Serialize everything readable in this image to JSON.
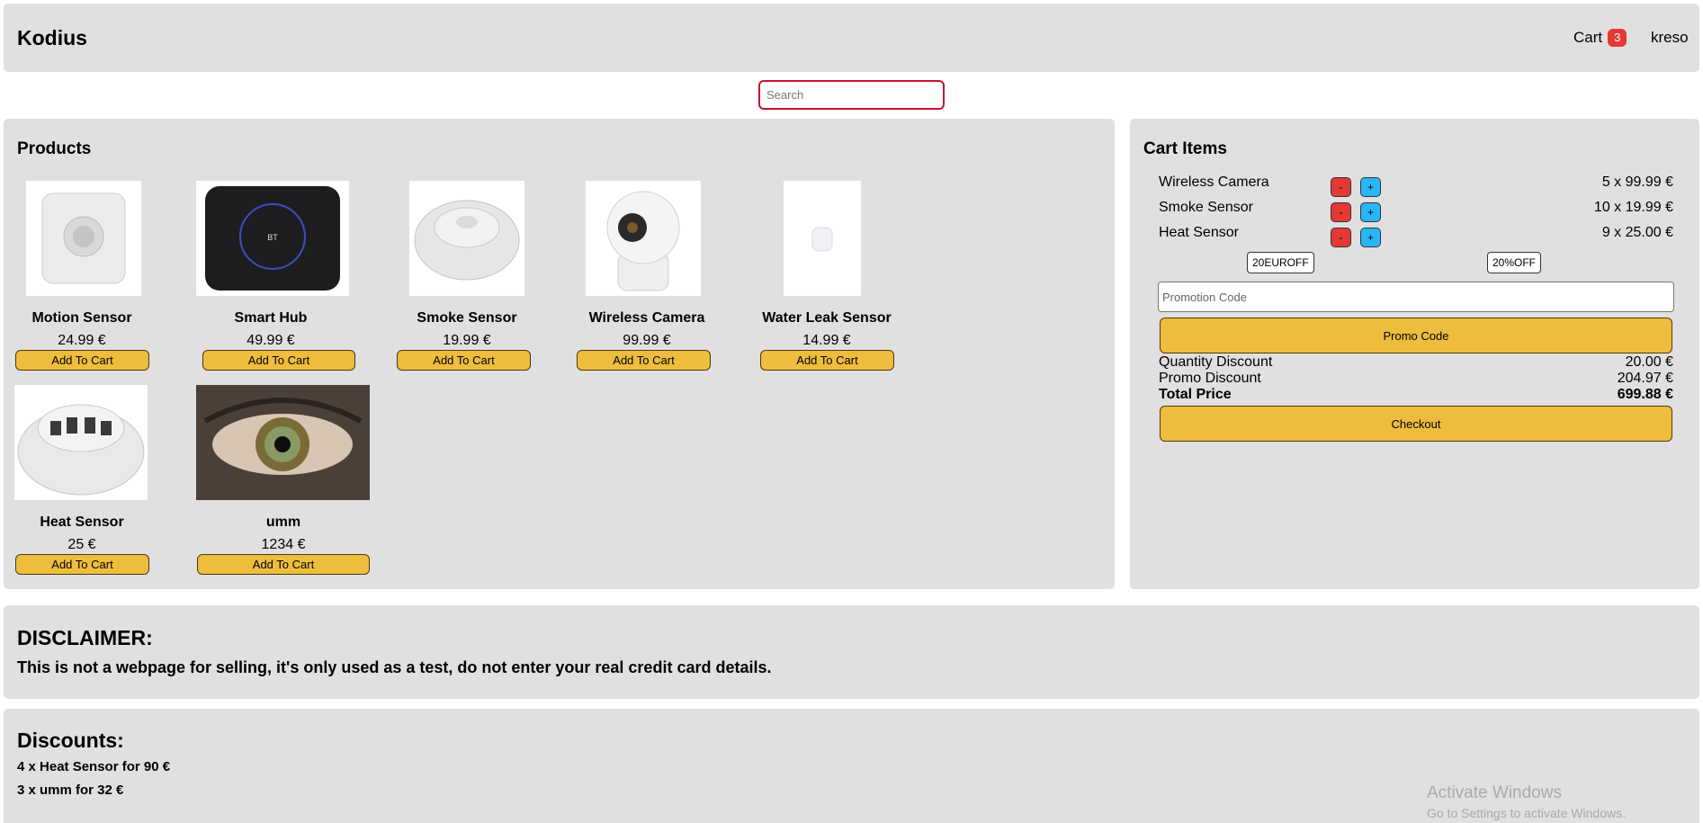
{
  "header": {
    "brand": "Kodius",
    "cart_label": "Cart",
    "cart_count": "3",
    "user": "kreso"
  },
  "search": {
    "placeholder": "Search"
  },
  "products": {
    "title": "Products",
    "add_label": "Add To Cart",
    "items": [
      {
        "name": "Motion Sensor",
        "price": "24.99 €"
      },
      {
        "name": "Smart Hub",
        "price": "49.99 €"
      },
      {
        "name": "Smoke Sensor",
        "price": "19.99 €"
      },
      {
        "name": "Wireless Camera",
        "price": "99.99 €"
      },
      {
        "name": "Water Leak Sensor",
        "price": "14.99 €"
      },
      {
        "name": "Heat Sensor",
        "price": "25 €"
      },
      {
        "name": "umm",
        "price": "1234 €"
      }
    ]
  },
  "cart": {
    "title": "Cart Items",
    "minus_label": "-",
    "plus_label": "+",
    "items": [
      {
        "name": "Wireless Camera",
        "qty": "5 x 99.99 €"
      },
      {
        "name": "Smoke Sensor",
        "qty": "10 x 19.99 €"
      },
      {
        "name": "Heat Sensor",
        "qty": "9 x 25.00 €"
      }
    ],
    "coupons": [
      "20EUROFF",
      "20%OFF"
    ],
    "promo_placeholder": "Promotion Code",
    "promo_button": "Promo Code",
    "quantity_discount_label": "Quantity Discount",
    "quantity_discount": "20.00 €",
    "promo_discount_label": "Promo Discount",
    "promo_discount": "204.97 €",
    "total_label": "Total Price",
    "total": "699.88 €",
    "checkout": "Checkout"
  },
  "disclaimer": {
    "title": "DISCLAIMER:",
    "text": "This is not a webpage for selling, it's only used as a test, do not enter your real credit card details."
  },
  "discounts": {
    "title": "Discounts:",
    "items": [
      "4 x Heat Sensor for 90 €",
      "3 x umm for 32 €"
    ]
  },
  "watermark": {
    "line1": "Activate Windows",
    "line2": "Go to Settings to activate Windows."
  },
  "colors": {
    "accent": "#efbd3d",
    "panel": "#e0e0e0",
    "badge": "#e53935",
    "minus": "#e53935",
    "plus": "#29b6f6",
    "search_border": "#c8102e"
  }
}
